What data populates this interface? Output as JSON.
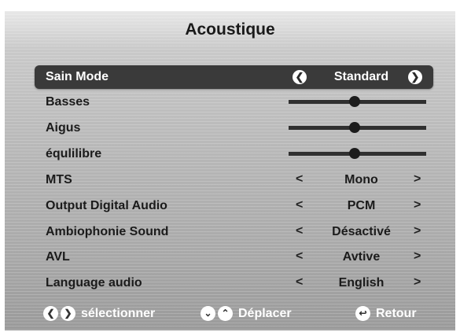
{
  "title": "Acoustique",
  "rows": [
    {
      "label": "Sain Mode",
      "kind": "select",
      "value": "Standard",
      "selected": true
    },
    {
      "label": "Basses",
      "kind": "slider",
      "level": 0.48
    },
    {
      "label": "Aigus",
      "kind": "slider",
      "level": 0.48
    },
    {
      "label": "équlilibre",
      "kind": "slider",
      "level": 0.48
    },
    {
      "label": "MTS",
      "kind": "select",
      "value": "Mono"
    },
    {
      "label": "Output Digital Audio",
      "kind": "select",
      "value": "PCM"
    },
    {
      "label": "Ambiophonie Sound",
      "kind": "select",
      "value": "Désactivé"
    },
    {
      "label": "AVL",
      "kind": "select",
      "value": "Avtive"
    },
    {
      "label": "Language audio",
      "kind": "select",
      "value": "English"
    }
  ],
  "arrows": {
    "left": "<",
    "right": ">"
  },
  "footer": {
    "select_label": "sélectionner",
    "move_label": "Déplacer",
    "back_label": "Retour"
  },
  "icons": {
    "left": "chevron-left-icon",
    "right": "chevron-right-icon",
    "down": "chevron-down-icon",
    "up": "chevron-up-icon",
    "back": "return-icon"
  }
}
